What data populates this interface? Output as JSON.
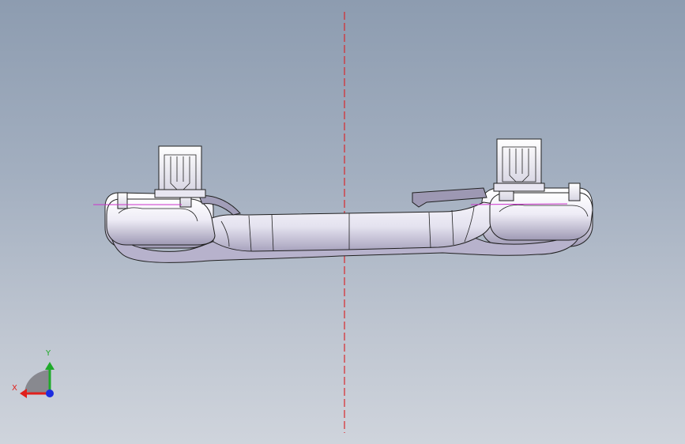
{
  "triad": {
    "x_label": "X",
    "y_label": "Y",
    "x_color": "#e0201c",
    "y_color": "#1faa2a",
    "z_color": "#1c2ce0"
  },
  "viewport": {
    "background_top": "#8d9cb0",
    "background_bottom": "#cfd4dc",
    "centerline_color": "#d8282c",
    "sketch_line_color": "#cc33cc"
  },
  "model": {
    "name": "grab-handle",
    "icon": "3d-part"
  }
}
